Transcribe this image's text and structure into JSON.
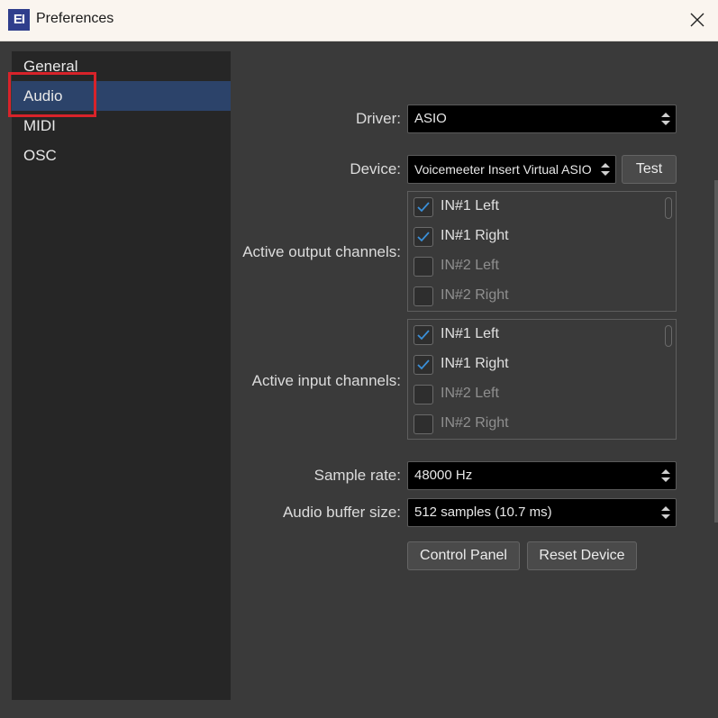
{
  "window": {
    "title": "Preferences",
    "app_icon": "EI"
  },
  "sidebar": {
    "items": [
      {
        "label": "General"
      },
      {
        "label": "Audio"
      },
      {
        "label": "MIDI"
      },
      {
        "label": "OSC"
      }
    ],
    "selected": "Audio"
  },
  "audio": {
    "driver_label": "Driver:",
    "driver_value": "ASIO",
    "device_label": "Device:",
    "device_value": "Voicemeeter Insert Virtual ASIO",
    "test_button": "Test",
    "output_label": "Active output channels:",
    "output_channels": [
      {
        "name": "IN#1 Left",
        "checked": true
      },
      {
        "name": "IN#1 Right",
        "checked": true
      },
      {
        "name": "IN#2 Left",
        "checked": false
      },
      {
        "name": "IN#2 Right",
        "checked": false
      }
    ],
    "input_label": "Active input channels:",
    "input_channels": [
      {
        "name": "IN#1 Left",
        "checked": true
      },
      {
        "name": "IN#1 Right",
        "checked": true
      },
      {
        "name": "IN#2 Left",
        "checked": false
      },
      {
        "name": "IN#2 Right",
        "checked": false
      }
    ],
    "sample_rate_label": "Sample rate:",
    "sample_rate_value": "48000 Hz",
    "buffer_label": "Audio buffer size:",
    "buffer_value": "512 samples (10.7 ms)",
    "control_panel_button": "Control Panel",
    "reset_device_button": "Reset Device"
  },
  "colors": {
    "accent_check": "#3a8fd8",
    "selection": "#2c436a",
    "annotation": "#d8232a"
  }
}
